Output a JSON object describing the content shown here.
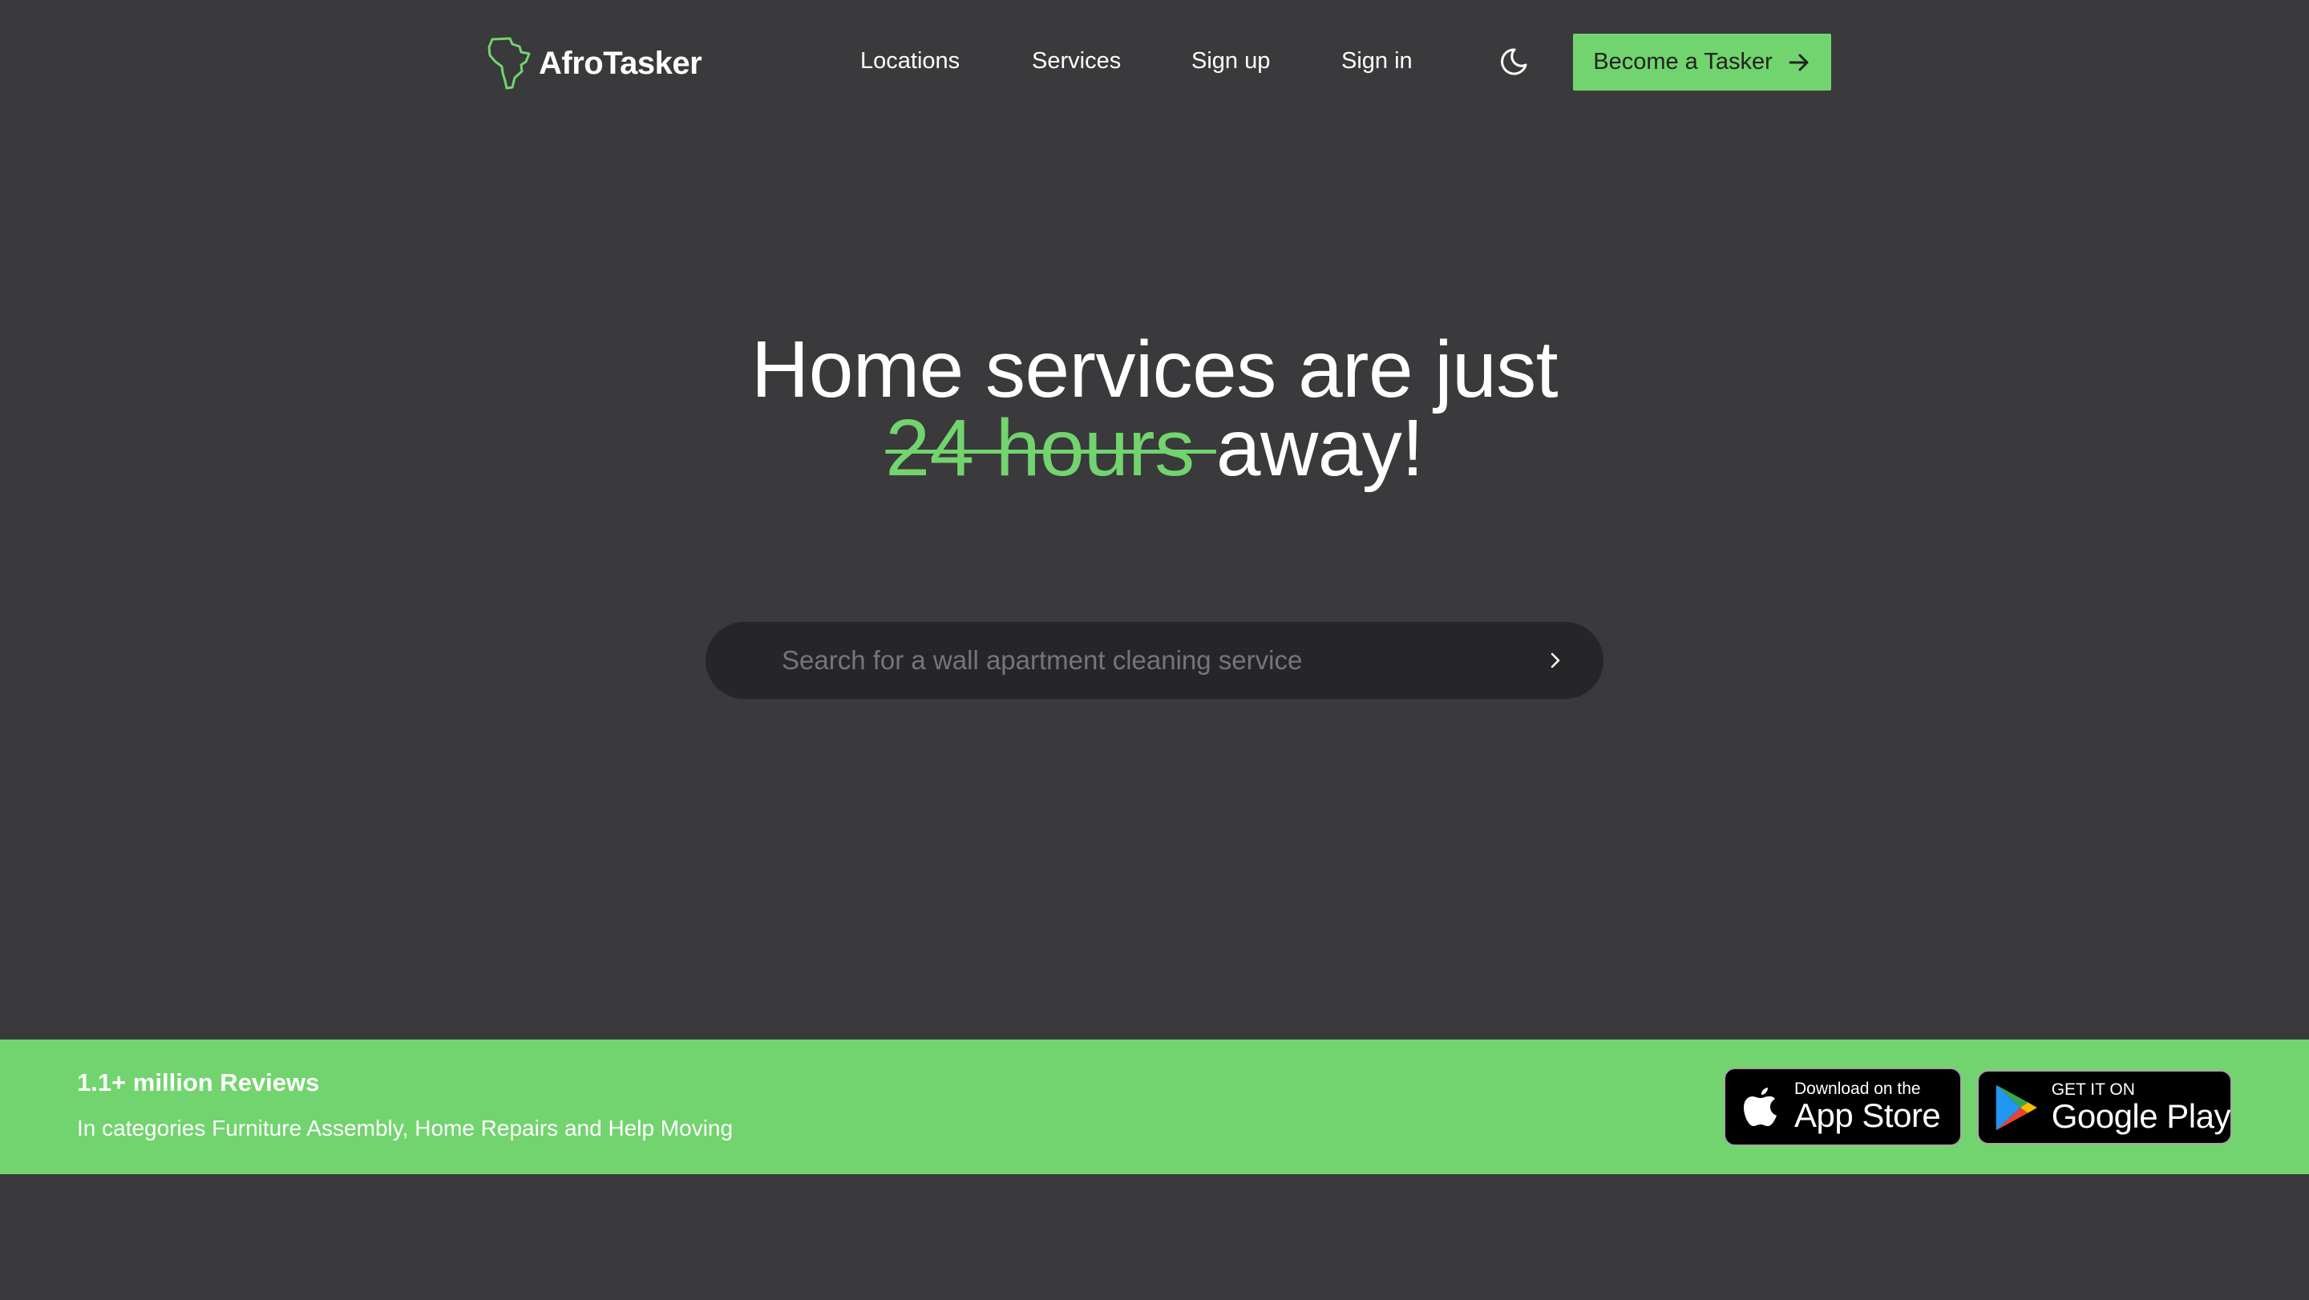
{
  "header": {
    "brand": "AfroTasker",
    "nav": {
      "locations": "Locations",
      "services": "Services",
      "sign_up": "Sign up",
      "sign_in": "Sign in"
    },
    "theme_toggle_icon": "moon-icon",
    "cta_label": "Become a Tasker",
    "cta_icon": "arrow-right-icon"
  },
  "hero": {
    "line1": "Home services are just",
    "struck": "24 hours ",
    "line2_end": "away!"
  },
  "search": {
    "placeholder": "Search for a wall apartment cleaning service",
    "value": "",
    "submit_icon": "chevron-right-icon"
  },
  "band": {
    "title": "1.1+ million Reviews",
    "subtitle": "In categories Furniture Assembly, Home Repairs and Help Moving",
    "app_store": {
      "small": "Download on the",
      "big": "App Store",
      "icon": "apple-icon"
    },
    "google_play": {
      "small": "GET IT ON",
      "big": "Google Play",
      "icon": "google-play-icon"
    }
  },
  "colors": {
    "background": "#3a393b",
    "accent": "#72d46e",
    "search_bg": "#262628",
    "text": "#ffffff"
  }
}
